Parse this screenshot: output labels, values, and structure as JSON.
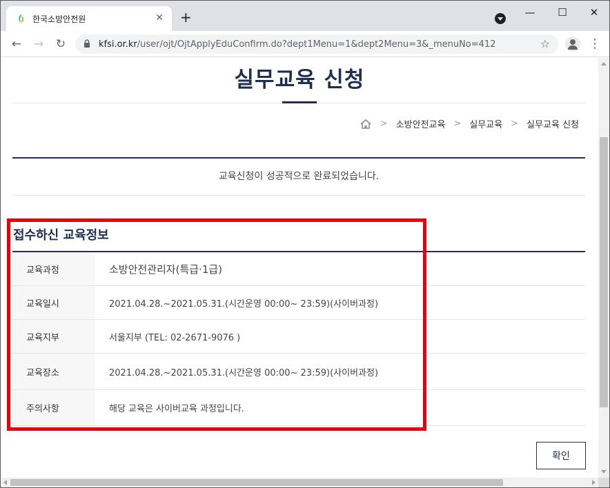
{
  "browser": {
    "tab_title": "한국소방안전원",
    "tab_close": "✕",
    "new_tab": "+",
    "url_host": "kfsi.or.kr",
    "url_path": "/user/ojt/OjtApplyEduConfirm.do?dept1Menu=1&dept2Menu=3&_menuNo=412",
    "back": "←",
    "forward": "→",
    "reload": "↻",
    "star": "☆",
    "menu": "⋮",
    "minimize": "—",
    "maximize": "☐",
    "close": "✕",
    "icons": {
      "favicon": "kfsi-favicon-icon",
      "lock": "lock-icon",
      "profile": "profile-icon"
    }
  },
  "page": {
    "title": "실무교육 신청",
    "breadcrumb": [
      "소방안전교육",
      "실무교육",
      "실무교육 신청"
    ],
    "breadcrumb_sep": ">",
    "success_message": "교육신청이 성공적으로 완료되었습니다.",
    "section_title": "접수하신 교육정보",
    "info_rows": [
      {
        "label": "교육과정",
        "value": "소방안전관리자(특급·1급)"
      },
      {
        "label": "교육일시",
        "value": "2021.04.28.~2021.05.31.(시간운영 00:00~ 23:59)(사이버과정)"
      },
      {
        "label": "교육지부",
        "value": "서울지부 (TEL: 02-2671-9076 )"
      },
      {
        "label": "교육장소",
        "value": "2021.04.28.~2021.05.31.(시간운영 00:00~ 23:59)(사이버과정)"
      },
      {
        "label": "주의사항",
        "value": "해당 교육은 사이버교육 과정입니다."
      }
    ],
    "confirm_label": "확인"
  },
  "colors": {
    "brand_navy": "#1e2f52",
    "highlight_red": "#e8000b",
    "label_bg": "#f7f7f7"
  }
}
